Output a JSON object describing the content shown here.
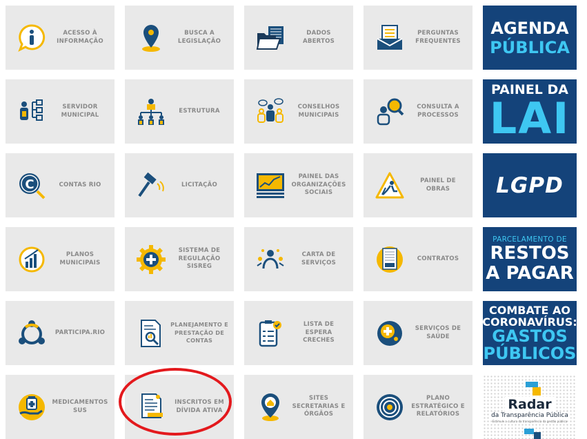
{
  "tiles": [
    {
      "id": "acesso",
      "label": "ACESSO À INFORMAÇÃO",
      "icon": "info-speech-bubble-icon"
    },
    {
      "id": "busca",
      "label": "BUSCA A LEGISLAÇÃO",
      "icon": "map-pin-icon"
    },
    {
      "id": "dados",
      "label": "DADOS ABERTOS",
      "icon": "open-folder-icon"
    },
    {
      "id": "perguntas",
      "label": "PERGUNTAS FREQUENTES",
      "icon": "documents-tray-icon"
    },
    {
      "id": "servidor",
      "label": "SERVIDOR MUNICIPAL",
      "icon": "org-tree-icon"
    },
    {
      "id": "estrutura",
      "label": "ESTRUTURA",
      "icon": "hierarchy-icon"
    },
    {
      "id": "conselhos",
      "label": "CONSELHOS MUNICIPAIS",
      "icon": "people-chat-icon"
    },
    {
      "id": "consulta",
      "label": "CONSULTA A PROCESSOS",
      "icon": "person-magnifier-icon"
    },
    {
      "id": "contas",
      "label": "CONTAS RIO",
      "icon": "copyright-magnifier-icon"
    },
    {
      "id": "licitacao",
      "label": "LICITAÇÃO",
      "icon": "gavel-icon"
    },
    {
      "id": "painel-os",
      "label": "PAINEL DAS ORGANIZAÇÕES SOCIAIS",
      "icon": "dashboard-chart-icon"
    },
    {
      "id": "painel-obras",
      "label": "PAINEL DE OBRAS",
      "icon": "construction-sign-icon"
    },
    {
      "id": "planos",
      "label": "PLANOS MUNICIPAIS",
      "icon": "bar-chart-circle-icon"
    },
    {
      "id": "sisreg",
      "label": "SISTEMA DE REGULAÇÃO SISREG",
      "icon": "gear-plus-icon"
    },
    {
      "id": "carta",
      "label": "CARTA DE SERVIÇOS",
      "icon": "person-stars-icon"
    },
    {
      "id": "contratos",
      "label": "CONTRATOS",
      "icon": "contract-document-icon"
    },
    {
      "id": "participa",
      "label": "PARTICIPA.RIO",
      "icon": "people-circle-icon"
    },
    {
      "id": "planejamento",
      "label": "PLANEJAMENTO E PRESTAÇÃO DE CONTAS",
      "icon": "document-magnifier-icon"
    },
    {
      "id": "creches",
      "label": "LISTA DE ESPERA CRECHES",
      "icon": "checklist-icon"
    },
    {
      "id": "saude",
      "label": "SERVIÇOS DE SAÚDE",
      "icon": "health-cross-icon"
    },
    {
      "id": "medicamentos",
      "label": "MEDICAMENTOS SUS",
      "icon": "medicine-hand-icon"
    },
    {
      "id": "divida",
      "label": "INSCRITOS EM DÍVIDA ATIVA",
      "icon": "debt-document-icon"
    },
    {
      "id": "sites",
      "label": "SITES SECRETARIAS E ÓRGÃOS",
      "icon": "home-pin-icon"
    },
    {
      "id": "plano",
      "label": "PLANO ESTRATÉGICO E RELATÓRIOS",
      "icon": "target-icon"
    }
  ],
  "promos": {
    "agenda": {
      "line1": "AGENDA",
      "line2": "PÚBLICA"
    },
    "painel_lai": {
      "line1": "PAINEL DA",
      "line2": "LAI"
    },
    "lgpd": {
      "line1": "LGPD"
    },
    "restos": {
      "line1": "PARCELAMENTO DE",
      "line2": "RESTOS",
      "line3": "A PAGAR"
    },
    "covid": {
      "line1": "COMBATE AO",
      "line2": "CORONAVÍRUS:",
      "line3": "GASTOS",
      "line4": "PÚBLICOS"
    },
    "radar": {
      "line1": "Radar",
      "line2": "da Transparência Pública",
      "line3": "Estimule a cultura da transparência da gestão pública"
    }
  },
  "colors": {
    "tile_bg": "#e9e9e9",
    "label": "#8a8a8a",
    "navy": "#14437a",
    "cyan": "#3ec7f2",
    "icon_blue": "#1b4f7c",
    "icon_yellow": "#f5b800",
    "highlight": "#e3191d"
  }
}
